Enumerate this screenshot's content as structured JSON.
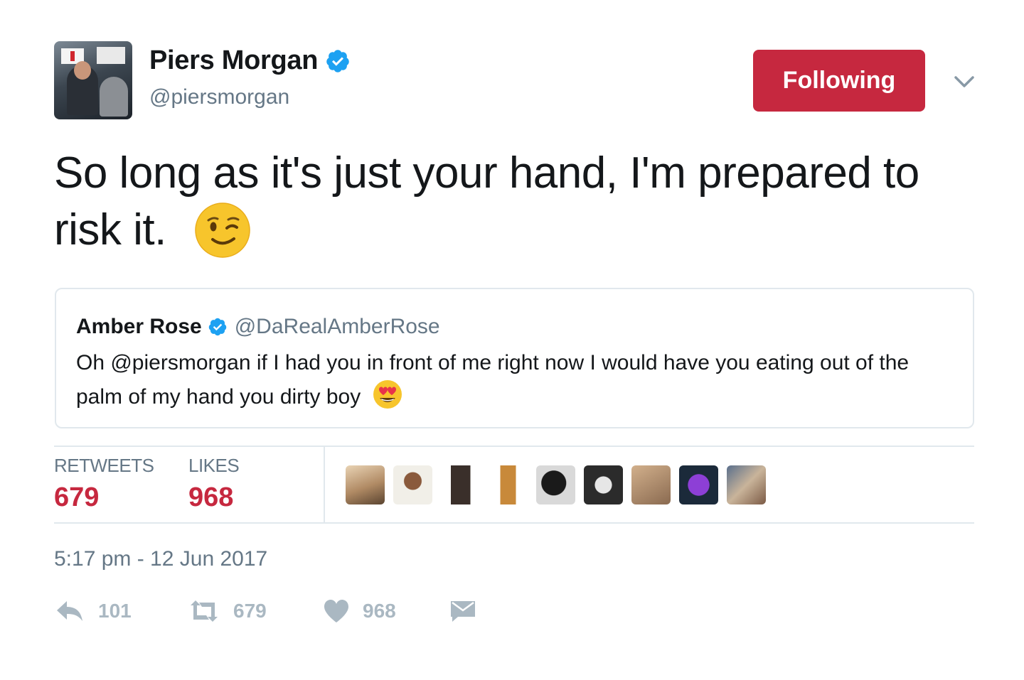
{
  "author": {
    "display_name": "Piers Morgan",
    "handle": "@piersmorgan",
    "verified": true
  },
  "follow_button": {
    "label": "Following",
    "color": "#c6283f"
  },
  "tweet": {
    "text": "So long as it's just your hand, I'm prepared to risk it.",
    "emoji_icon": "winking-face-emoji"
  },
  "quoted_tweet": {
    "display_name": "Amber Rose",
    "handle": "@DaRealAmberRose",
    "verified": true,
    "text": "Oh @piersmorgan if I had you in front of me right now I would have you eating out of the palm of my hand you dirty boy",
    "emoji_icon": "heart-eyes-emoji"
  },
  "stats": {
    "retweets_label": "RETWEETS",
    "retweets_value": "679",
    "likes_label": "LIKES",
    "likes_value": "968"
  },
  "likers_count": 9,
  "timestamp": "5:17 pm - 12 Jun 2017",
  "actions": {
    "reply_count": "101",
    "retweet_count": "679",
    "like_count": "968"
  },
  "colors": {
    "accent": "#c6283f",
    "verified_blue": "#1da1f2",
    "muted_text": "#657786",
    "action_gray": "#aab8c2",
    "border": "#e1e8ed"
  }
}
